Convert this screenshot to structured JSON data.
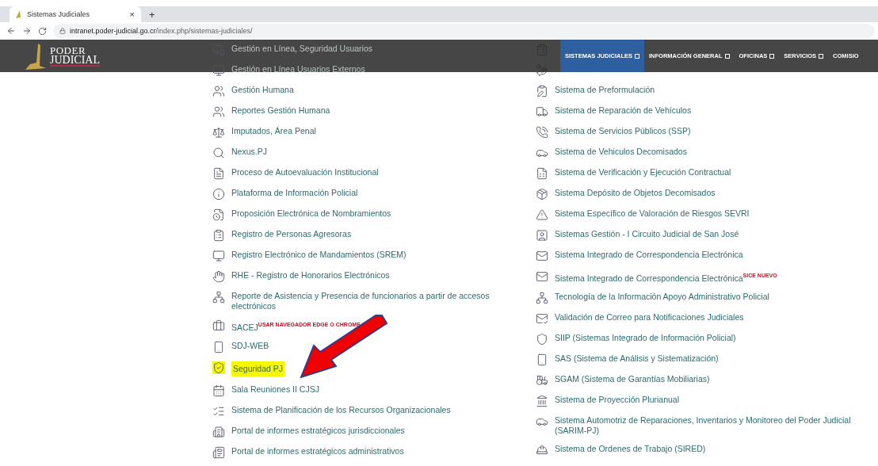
{
  "browser": {
    "tab": {
      "title": "Sistemas Judiciales",
      "close": "×",
      "new_tab": "+"
    },
    "url": {
      "domain": "intranet.poder-judicial.go.cr",
      "path": "/index.php/sistemas-judiciales/"
    }
  },
  "header": {
    "logo": {
      "line_1": "PODER",
      "line_2": "JUDICIAL"
    },
    "nav": [
      {
        "label": "SISTEMAS JUDICIALES",
        "selected": true
      },
      {
        "label": "INFORMACIÓN GENERAL",
        "selected": false
      },
      {
        "label": "OFICINAS",
        "selected": false
      },
      {
        "label": "SERVICIOS",
        "selected": false
      },
      {
        "label": "COMISIO",
        "selected": false
      }
    ]
  },
  "behind_header": [
    {
      "label": "Gestión en Línea, Seguridad Usuarios"
    },
    {
      "label": "Gestión en Línea Usuarios Externos"
    }
  ],
  "left_column": [
    {
      "label": "Gestión Humana",
      "highlighted": false
    },
    {
      "label": "Reportes Gestión Humana",
      "highlighted": false
    },
    {
      "label": "Imputados, Área Penal",
      "highlighted": false
    },
    {
      "label": "Nexus.PJ",
      "highlighted": false
    },
    {
      "label": "Proceso de Autoevaluación Institucional",
      "highlighted": false
    },
    {
      "label": "Plataforma de Información Policial",
      "highlighted": false
    },
    {
      "label": "Proposición Electrónica de Nombramientos",
      "highlighted": false
    },
    {
      "label": "Registro de Personas Agresoras",
      "highlighted": false
    },
    {
      "label": "Registro Electrónico de Mandamientos (SREM)",
      "highlighted": false
    },
    {
      "label": "RHE - Registro de Honorarios Electrónicos",
      "highlighted": false
    },
    {
      "label": "Reporte de Asistencia y Presencia de funcionarios a partir de accesos electrónicos",
      "highlighted": false
    },
    {
      "label": "SACEJ",
      "note": "USAR NAVEGADOR EDGE O CHROME",
      "highlighted": false
    },
    {
      "label": "SDJ-WEB",
      "highlighted": false
    },
    {
      "label": "Seguridad PJ",
      "highlighted": true
    },
    {
      "label": "Sala Reuniones II CJSJ",
      "highlighted": false
    },
    {
      "label": "Sistema de Planificación de los Recursos Organizacionales",
      "highlighted": false
    },
    {
      "label": "Portal de informes estratégicos jurisdiccionales",
      "highlighted": false
    },
    {
      "label": "Portal de informes estratégicos administrativos",
      "highlighted": false
    }
  ],
  "right_column": [
    {
      "label": "Sistema de Preformulación"
    },
    {
      "label": "Sistema de Reparación de Vehículos"
    },
    {
      "label": "Sistema de Servicios Públicos (SSP)"
    },
    {
      "label": "Sistema de Vehiculos Decomisados"
    },
    {
      "label": "Sistema de Verificación y Ejecución Contractual"
    },
    {
      "label": "Sistema Depósito de Objetos Decomisados"
    },
    {
      "label": "Sistema Específico de Valoración de Riesgos SEVRI"
    },
    {
      "label": "Sistemas Gestión - I Circuito Judicial de San José"
    },
    {
      "label": "Sistema Integrado de Correspondencia Electrónica"
    },
    {
      "label": "Sistema Integrado de Correspondencia Electrónica",
      "note": "SICE NUEVO"
    },
    {
      "label": "Tecnología de la Información Apoyo Administrativo Policial"
    },
    {
      "label": "Validación de Correo para Notificaciones Judiciales"
    },
    {
      "label": "SIIP (Sistemas Integrado de Información Policial)"
    },
    {
      "label": "SAS (Sistema de Análisis y Sistematización)"
    },
    {
      "label": "SGAM (Sistema de Garantías Mobiliarias)"
    },
    {
      "label": "Sistema de Proyección Plurianual"
    },
    {
      "label": "Sistema Automotriz de Reparaciones, Inventarios y Monitoreo del Poder Judicial (SARIM-PJ)"
    },
    {
      "label": "Sistema de Ordenes de Trabajo (SIRED)"
    }
  ]
}
